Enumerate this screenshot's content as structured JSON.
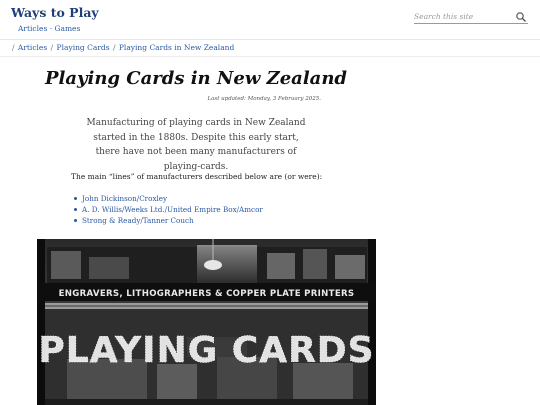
{
  "header": {
    "site_title": "Ways to Play",
    "nav": [
      "Articles",
      "Games"
    ],
    "nav_separator": "·",
    "search_placeholder": "Search this site",
    "search_icon": "search-icon"
  },
  "breadcrumb": {
    "items": [
      "Articles",
      "Playing Cards",
      "Playing Cards in New Zealand"
    ],
    "separator": "/"
  },
  "article": {
    "title": "Playing Cards in New Zealand",
    "updated": "Last updated: Monday, 3 February 2025.",
    "intro": "Manufacturing of playing cards in New Zealand started in the 1880s. Despite this early start, there have not been many manufacturers of playing-cards.",
    "lines_lead": "The main “lines” of manufacturers described below are (or were):",
    "manufacturers": [
      "John Dickinson/Croxley",
      "A. D. Willis/Weeks Ltd./United Empire Box/Amcor",
      "Strong & Ready/Tanner Couch"
    ],
    "photo": {
      "sign_text": "ENGRAVERS, LITHOGRAPHERS & COPPER PLATE PRINTERS",
      "window_text": "PLAYING CARDS"
    }
  },
  "colors": {
    "link": "#2b5aa3",
    "title_blue": "#1d3f7a",
    "photo_dark": "#111111"
  }
}
